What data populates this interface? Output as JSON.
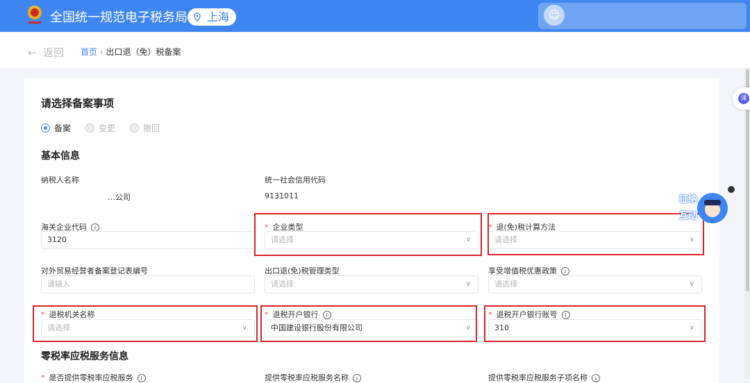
{
  "header": {
    "site_title": "全国统一规范电子税务局",
    "location": "上海",
    "location_icon": "map-pin-icon"
  },
  "breadcrumb": {
    "back": "返回",
    "home": "首页",
    "current": "出口退（免）税备案",
    "separator": "›"
  },
  "form": {
    "section_select": "请选择备案事项",
    "radios": [
      {
        "label": "备案",
        "checked": true,
        "disabled": false
      },
      {
        "label": "变更",
        "checked": false,
        "disabled": true
      },
      {
        "label": "撤回",
        "checked": false,
        "disabled": true
      }
    ],
    "section_basic": "基本信息",
    "taxpayer_name_label": "纳税人名称",
    "taxpayer_name_value": "…公司",
    "credit_code_label": "统一社会信用代码",
    "credit_code_value": "9131011",
    "fields": [
      {
        "label": "海关企业代码",
        "required": false,
        "info": true,
        "value": "3120",
        "placeholder": "",
        "select": false
      },
      {
        "label": "企业类型",
        "required": true,
        "info": false,
        "value": "",
        "placeholder": "请选择",
        "select": true
      },
      {
        "label": "退(免)税计算方法",
        "required": true,
        "info": false,
        "value": "",
        "placeholder": "请选择",
        "select": true
      },
      {
        "label": "对外贸易经营者备案登记表编号",
        "required": false,
        "info": false,
        "value": "",
        "placeholder": "请输入",
        "select": false
      },
      {
        "label": "出口退(免)税管理类型",
        "required": false,
        "info": false,
        "value": "",
        "placeholder": "请选择",
        "select": true
      },
      {
        "label": "享受增值税优惠政策",
        "required": false,
        "info": true,
        "value": "",
        "placeholder": "请选择",
        "select": true
      },
      {
        "label": "退税机关名称",
        "required": true,
        "info": false,
        "value": "",
        "placeholder": "请选择",
        "select": true
      },
      {
        "label": "退税开户银行",
        "required": true,
        "info": true,
        "value": "中国建设银行股份有限公司",
        "placeholder": "",
        "select": true
      },
      {
        "label": "退税开户银行账号",
        "required": true,
        "info": true,
        "value": "310",
        "placeholder": "",
        "select": true
      }
    ],
    "section_zero": "零税率应税服务信息",
    "zero_fields": [
      {
        "label": "是否提供零税率应税服务",
        "required": true
      },
      {
        "label": "提供零税率应税服务名称",
        "required": false
      },
      {
        "label": "提供零税率应税服务子项名称",
        "required": false
      }
    ]
  },
  "widgets": {
    "translate": "译",
    "mascot": "征纳互动",
    "user_icon": "user-icon"
  },
  "colors": {
    "brand": "#3f86f2",
    "highlight": "#d8232a",
    "required": "#e55"
  },
  "glyphs": {
    "back_arrow": "←",
    "chevron": "∨",
    "info": "i",
    "asterisk": "*"
  }
}
